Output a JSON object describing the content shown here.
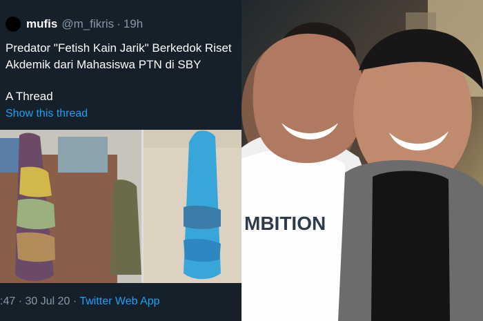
{
  "tweet": {
    "name": "mufis",
    "handle": "@m_fikris",
    "age": "19h",
    "text_line1": "Predator \"Fetish Kain Jarik\" Berkedok Riset Akdemik dari Mahasiswa PTN di SBY",
    "text_line2": "A Thread",
    "show_thread": "Show this thread",
    "footer_time": ":47",
    "footer_date": "30 Jul 20",
    "footer_source": "Twitter Web App"
  },
  "photo": {
    "shirt_text": "MBITION"
  },
  "colors": {
    "tweet_bg": "#15202b",
    "link": "#1da1f2",
    "muted": "#8899a6"
  }
}
